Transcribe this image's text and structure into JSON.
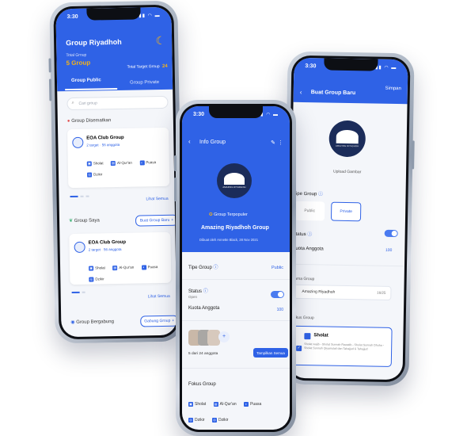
{
  "status_time": "3:30",
  "left": {
    "title": "Group Riyadhoh",
    "total_group_label": "Total Group",
    "total_group_value": "5 Group",
    "total_target_label": "Total Target Group",
    "total_target_value": "24",
    "tab_public": "Group Public",
    "tab_private": "Group Private",
    "search_placeholder": "Cari group",
    "disematkan_label": "Group Disematkan",
    "card1": {
      "name": "EOA Club Group",
      "target": "2 target",
      "sep": " · ",
      "members": "56 anggota",
      "chips": [
        "Sholat",
        "Al-Qur'an",
        "Puasa",
        "Dzikir"
      ]
    },
    "lihat_semua": "Lihat Semua",
    "group_saya_label": "Group Saya",
    "buat_group_btn": "Buat Group Baru",
    "card2": {
      "name": "EOA Club Group",
      "target": "2 target",
      "sep": " · ",
      "members": "56 anggota",
      "chips": [
        "Sholat",
        "Al-Qur'an",
        "Puasa",
        "Dzikir"
      ]
    },
    "lihat_semua2": "Lihat Semua",
    "bergabung_label": "Group Bergabung",
    "gabung_btn": "Gabung Group"
  },
  "middle": {
    "header_title": "Info Group",
    "badge": "Group Terpopuler",
    "group_name": "Amazing Riyadhoh Group",
    "created_by": "Dibuat oleh Annette Black, 28 Nov 2021",
    "tipe_label": "Tipe Group",
    "tipe_value": "Public",
    "status_label": "Status",
    "status_value": "Open",
    "kuota_label": "Kuota Anggota",
    "kuota_value": "100",
    "members_text": "5 dari 24 anggota",
    "tampilkan_btn": "Tampilkan Semua",
    "fokus_label": "Fokus Group",
    "fokus_chips": [
      "Sholat",
      "Al-Qur'an",
      "Puasa",
      "Dzikir",
      "Dzikir"
    ],
    "logo_text": "AMAZING RIYADHOH"
  },
  "right": {
    "header_title": "Buat Group Baru",
    "simpan": "Simpan",
    "upload_label": "Upload Gambar",
    "tipe_label": "Tipe Group",
    "opt_public": "Public",
    "opt_private": "Private",
    "status_label": "Status",
    "kuota_label": "Kuota Anggota",
    "kuota_value": "100",
    "nama_label": "Nama Group",
    "nama_value": "Amazing Riyadhoh",
    "nama_count": "16/25",
    "fokus_label": "Fokus Group",
    "fokus_item": "Sholat",
    "fokus_desc": "Sholat wajib - Sholat Sunnah Rawatib - Sholat Sunnah Dhuha - Sholat Sunnah Qiyamulail dan Tahajjud & Tahajjud",
    "logo_text": "AMAZING RIYADHOH"
  },
  "colors": {
    "primary": "#2f62e6",
    "accent_gold": "#f3b21a",
    "logo_bg": "#1b2c5a"
  }
}
